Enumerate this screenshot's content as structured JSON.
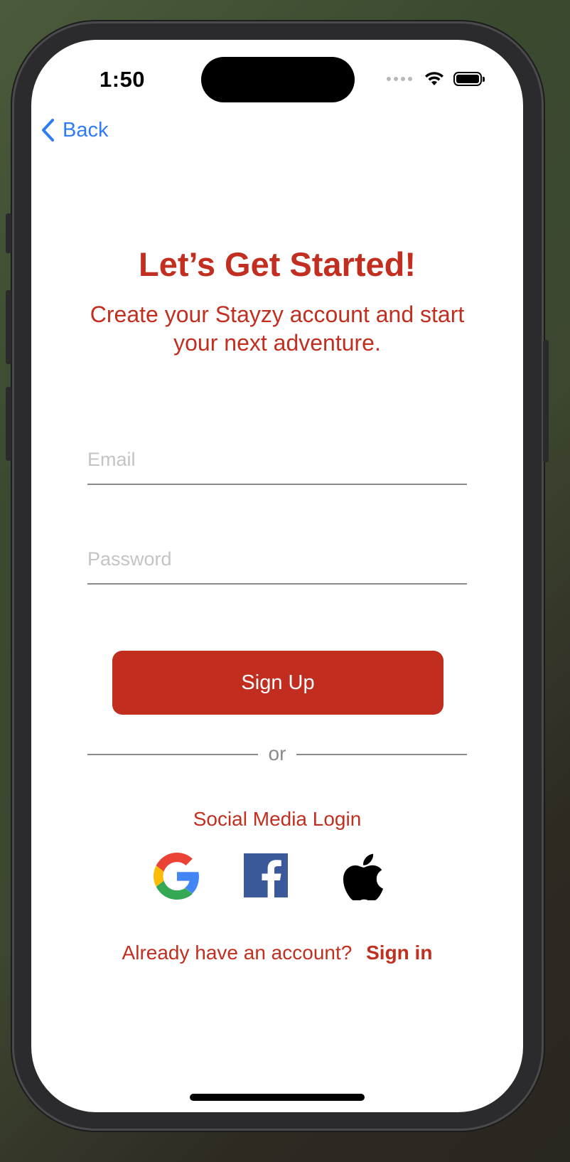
{
  "status_bar": {
    "time": "1:50"
  },
  "nav": {
    "back_label": "Back"
  },
  "header": {
    "title": "Let’s Get Started!",
    "subtitle": "Create your Stayzy account and start your next adventure."
  },
  "form": {
    "email_placeholder": "Email",
    "email_value": "",
    "password_placeholder": "Password",
    "password_value": "",
    "submit_label": "Sign Up"
  },
  "divider": {
    "text": "or"
  },
  "social": {
    "label": "Social Media Login",
    "providers": [
      "google-icon",
      "facebook-icon",
      "apple-icon"
    ]
  },
  "footer": {
    "prompt": "Already have an account?",
    "link_label": "Sign in"
  },
  "colors": {
    "brand_red": "#c22e1f",
    "link_blue": "#2f7cf6",
    "facebook_blue": "#3b5998"
  }
}
